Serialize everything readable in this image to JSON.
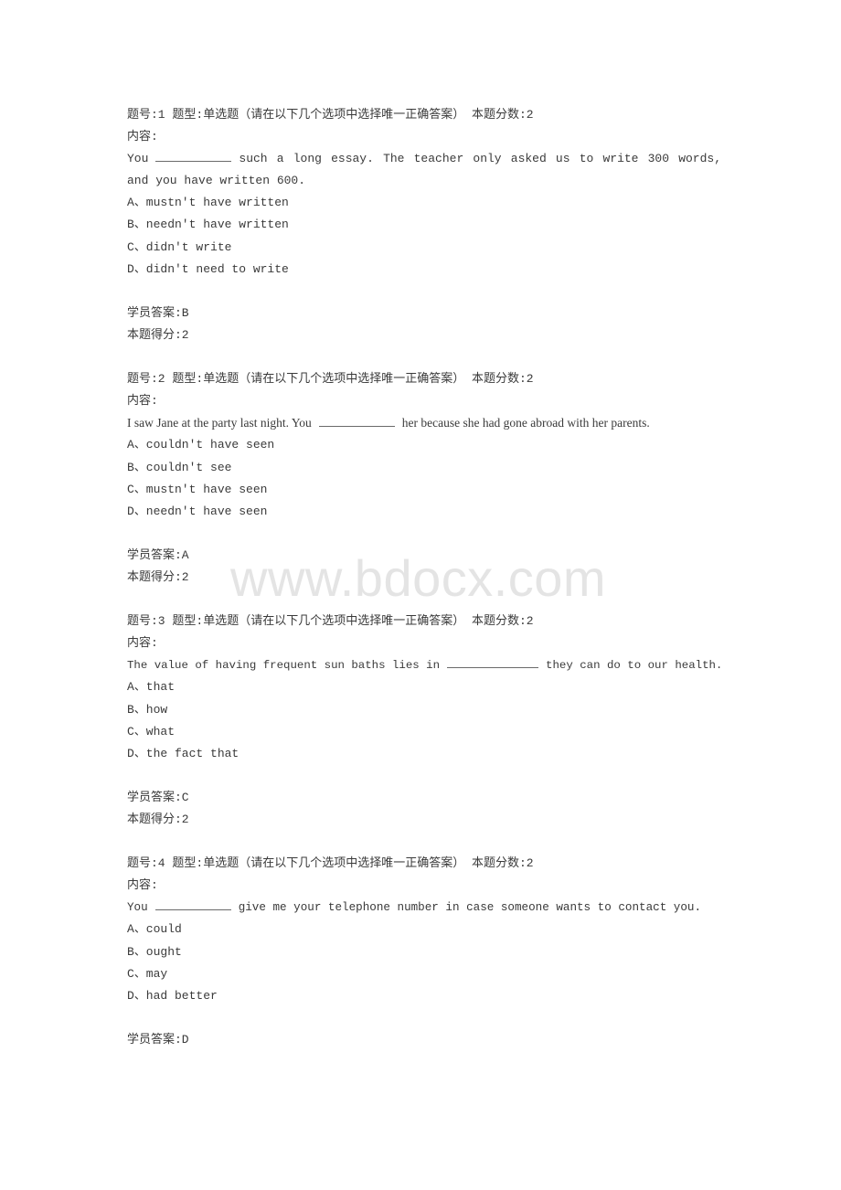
{
  "watermark": "www.bdocx.com",
  "labels": {
    "content": "内容:",
    "student_answer_prefix": "学员答案:",
    "score_prefix": "本题得分:"
  },
  "questions": [
    {
      "header": "题号:1 题型:单选题（请在以下几个选项中选择唯一正确答案） 本题分数:2",
      "content_label": "内容:",
      "stem_before": "You",
      "stem_after": "such a long essay. The teacher only asked us to write 300 words, and you have written 600.",
      "options": [
        "A、mustn't have written",
        "B、needn't have written",
        "C、didn't write",
        "D、didn't need to write"
      ],
      "student_answer": "学员答案:B",
      "score": "本题得分:2"
    },
    {
      "header": "题号:2 题型:单选题（请在以下几个选项中选择唯一正确答案） 本题分数:2",
      "content_label": "内容:",
      "stem_before": "I saw Jane at the party last night. You",
      "stem_after": "her because she had gone abroad with her parents.",
      "options": [
        "A、couldn't have seen",
        "B、couldn't see",
        "C、mustn't have seen",
        "D、needn't have seen"
      ],
      "student_answer": "学员答案:A",
      "score": "本题得分:2"
    },
    {
      "header": "题号:3 题型:单选题（请在以下几个选项中选择唯一正确答案） 本题分数:2",
      "content_label": "内容:",
      "stem_before": "The value of having frequent sun baths lies in",
      "stem_after": "they can do to our health.",
      "options": [
        "A、that",
        "B、how",
        "C、what",
        "D、the fact that"
      ],
      "student_answer": "学员答案:C",
      "score": "本题得分:2"
    },
    {
      "header": "题号:4 题型:单选题（请在以下几个选项中选择唯一正确答案） 本题分数:2",
      "content_label": "内容:",
      "stem_before": "You",
      "stem_after": "give me your telephone number in case someone wants to contact you.",
      "options": [
        "A、could",
        "B、ought",
        "C、may",
        "D、had better"
      ],
      "student_answer": "学员答案:D"
    }
  ]
}
